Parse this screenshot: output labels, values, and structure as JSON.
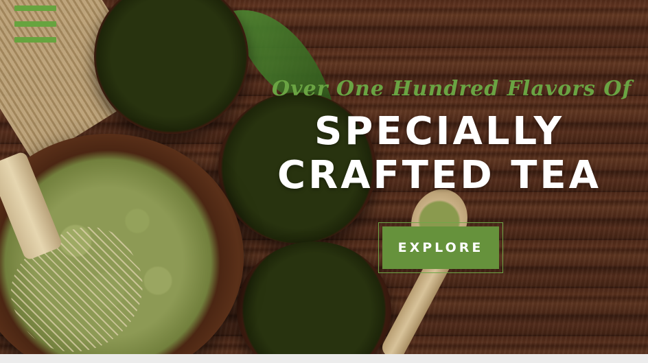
{
  "hero": {
    "tagline": "Over One Hundred Flavors Of",
    "headline_line1": "SPECIALLY",
    "headline_line2": "CRAFTED TEA",
    "cta_label": "EXPLORE"
  },
  "nav": {
    "menu_icon": "hamburger-menu-icon"
  },
  "colors": {
    "accent_green": "#67a43f",
    "button_green": "#66923c",
    "headline_white": "#ffffff",
    "page_strip": "#ececec"
  },
  "background": {
    "subject": "matcha bowls, green tea powder, bamboo whisk on dark wood"
  }
}
